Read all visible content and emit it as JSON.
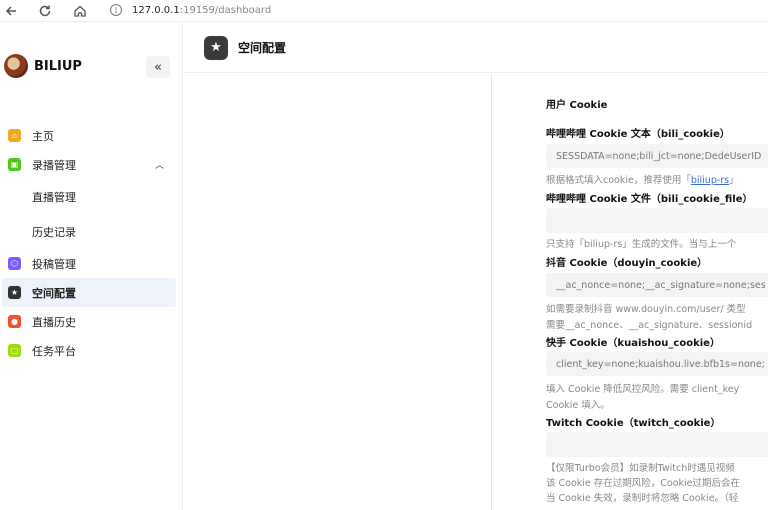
{
  "browser": {
    "url_host": "127.0.0.1",
    "url_path": ":19159/dashboard"
  },
  "sidebar": {
    "brand": "BILIUP",
    "collapse_glyph": "«",
    "items": [
      {
        "label": "主页",
        "icon": "home-icon",
        "color": "#f5a623"
      },
      {
        "label": "录播管理",
        "icon": "record-icon",
        "color": "#52c41a",
        "expanded": true
      },
      {
        "label": "直播管理",
        "sub": true
      },
      {
        "label": "历史记录",
        "sub": true
      },
      {
        "label": "投稿管理",
        "icon": "upload-icon",
        "color": "#7c5cff"
      },
      {
        "label": "空间配置",
        "icon": "star-icon",
        "color": "#333333",
        "active": true
      },
      {
        "label": "直播历史",
        "icon": "live-history-icon",
        "color": "#f5532d"
      },
      {
        "label": "任务平台",
        "icon": "task-icon",
        "color": "#a0d911"
      }
    ]
  },
  "header": {
    "title": "空间配置"
  },
  "form": {
    "section_title": "用户 Cookie",
    "fields": [
      {
        "label": "哔哩哔哩 Cookie 文本（bili_cookie）",
        "value": "SESSDATA=none;bili_jct=none;DedeUserID",
        "help1_pre": "根据格式填入cookie，推荐使用「",
        "help1_link": "biliup-rs",
        "help1_post": "」"
      },
      {
        "label": "哔哩哔哩 Cookie 文件（bili_cookie_file）",
        "value": "",
        "help1": "只支持「biliup-rs」生成的文件。当与上一个"
      },
      {
        "label": "抖音 Cookie（douyin_cookie）",
        "value": "__ac_nonce=none;__ac_signature=none;ses",
        "help1": "如需要录制抖音 www.douyin.com/user/ 类型",
        "help2": "需要__ac_nonce、__ac_signature、sessionid"
      },
      {
        "label": "快手 Cookie（kuaishou_cookie）",
        "value": "client_key=none;kuaishou.live.bfb1s=none;",
        "help1": "填入 Cookie 降低风控风险。需要 client_key",
        "help2": "Cookie 填入。"
      },
      {
        "label": "Twitch Cookie（twitch_cookie）",
        "value": "",
        "help1": "【仅限Turbo会员】如录制Twitch时遇见视频",
        "help2": "该 Cookie 存在过期风险，Cookie过期后会在",
        "help3": "当 Cookie 失效，录制时将忽略 Cookie。（轻"
      }
    ]
  }
}
